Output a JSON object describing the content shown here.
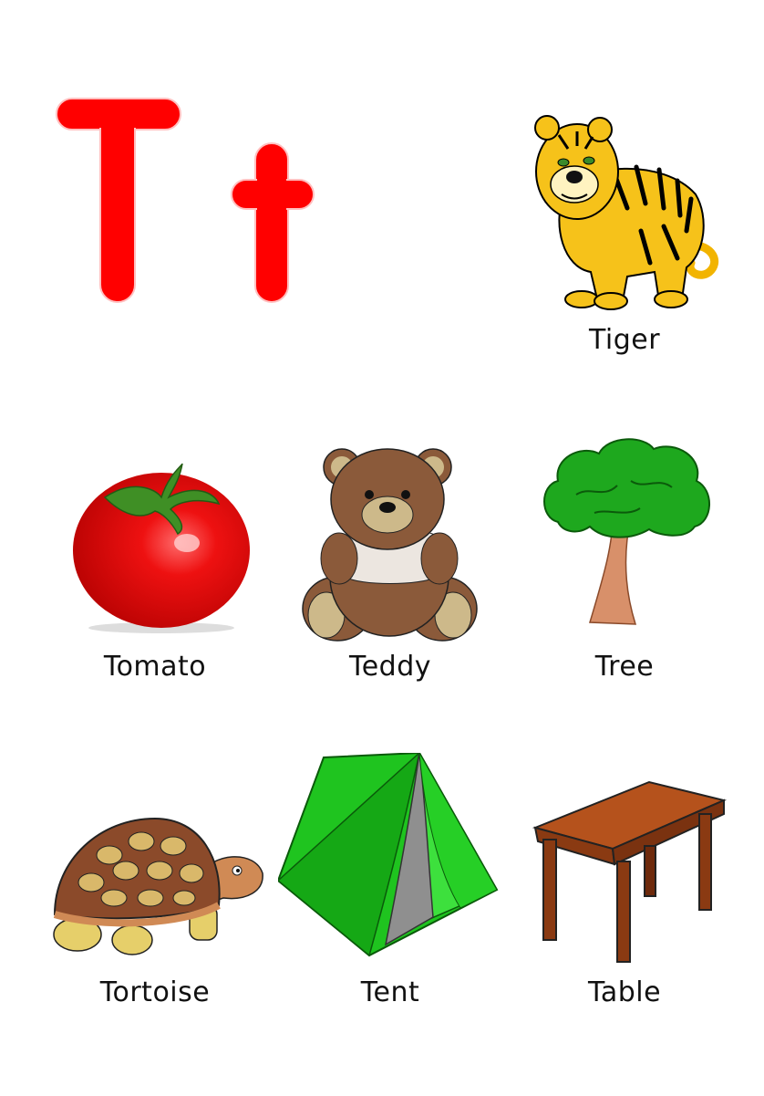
{
  "letters": {
    "upper": "T",
    "lower": "t"
  },
  "items": [
    {
      "label": "Tiger",
      "icon": "tiger-icon"
    },
    {
      "label": "Tomato",
      "icon": "tomato-icon"
    },
    {
      "label": "Teddy",
      "icon": "teddy-bear-icon"
    },
    {
      "label": "Tree",
      "icon": "tree-icon"
    },
    {
      "label": "Tortoise",
      "icon": "tortoise-icon"
    },
    {
      "label": "Tent",
      "icon": "tent-icon"
    },
    {
      "label": "Table",
      "icon": "table-icon"
    }
  ],
  "colors": {
    "letter": "#ff0000",
    "letter_outline": "#ffb3b3"
  }
}
